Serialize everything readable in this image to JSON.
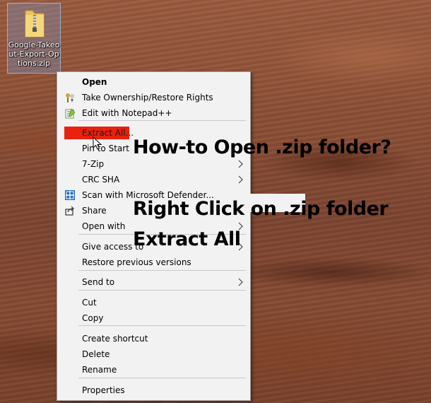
{
  "desktop": {
    "icon": {
      "name": "zip-folder-icon",
      "label": "Google-Takeout-Export-Options.zip"
    }
  },
  "context_menu": {
    "items": [
      {
        "label": "Open",
        "bold": true,
        "icon": ""
      },
      {
        "label": "Take Ownership/Restore Rights",
        "icon": "ownership-icon"
      },
      {
        "label": "Edit with Notepad++",
        "icon": "notepad-plus-plus-icon"
      },
      {
        "label": "Extract All...",
        "highlighted": true
      },
      {
        "label": "Pin to Start"
      },
      {
        "label": "7-Zip",
        "submenu": true
      },
      {
        "label": "CRC SHA",
        "submenu": true
      },
      {
        "label": "Scan with Microsoft Defender...",
        "icon": "defender-shield-icon"
      },
      {
        "label": "Share",
        "icon": "share-icon"
      },
      {
        "label": "Open with",
        "submenu": true
      },
      {
        "label": "Give access to",
        "submenu": true
      },
      {
        "label": "Restore previous versions"
      },
      {
        "label": "Send to",
        "submenu": true
      },
      {
        "label": "Cut"
      },
      {
        "label": "Copy"
      },
      {
        "label": "Create shortcut"
      },
      {
        "label": "Delete"
      },
      {
        "label": "Rename"
      },
      {
        "label": "Properties"
      }
    ]
  },
  "overlay": {
    "line1": "How-to Open .zip folder?",
    "line2": "Right Click on .zip folder",
    "line3": "Extract All"
  },
  "colors": {
    "highlight": "#e9210e",
    "menu_bg": "#f2f2f2"
  }
}
